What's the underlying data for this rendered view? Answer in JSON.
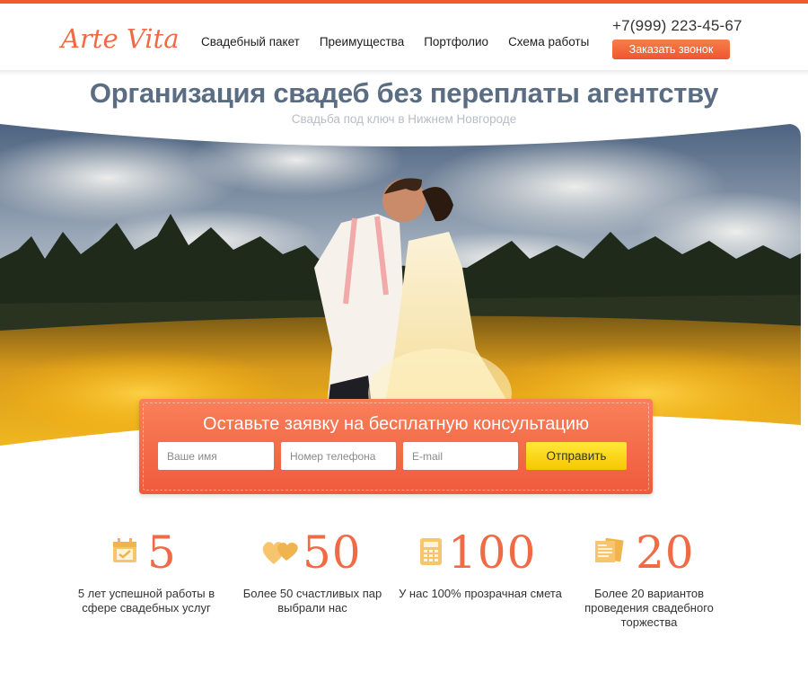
{
  "header": {
    "logo_text": "Arte Vita",
    "nav": [
      {
        "label": "Свадебный пакет"
      },
      {
        "label": "Преимущества"
      },
      {
        "label": "Портфолио"
      },
      {
        "label": "Схема работы"
      }
    ],
    "phone": "+7(999) 223-45-67",
    "call_button_label": "Заказать звонок"
  },
  "hero": {
    "title": "Организация свадеб без переплаты агентству",
    "subtitle": "Свадьба под ключ в Нижнем Новгороде"
  },
  "form": {
    "title": "Оставьте заявку на бесплатную консультацию",
    "name_placeholder": "Ваше имя",
    "phone_placeholder": "Номер телефона",
    "email_placeholder": "E-mail",
    "submit_label": "Отправить"
  },
  "stats": [
    {
      "icon": "calendar-icon",
      "number": "5",
      "text": "5 лет успешной работы в сфере свадебных услуг"
    },
    {
      "icon": "hearts-icon",
      "number": "50",
      "text": "Более 50 счастливых пар выбрали нас"
    },
    {
      "icon": "calculator-icon",
      "number": "100",
      "text": "У нас 100% прозрачная смета"
    },
    {
      "icon": "documents-icon",
      "number": "20",
      "text": "Более 20 вариантов проведения свадебного торжества"
    }
  ],
  "colors": {
    "accent": "#f15b2c",
    "icon": "#f7c56e",
    "title": "#5a6d82",
    "button_yellow": "#f6c700"
  }
}
